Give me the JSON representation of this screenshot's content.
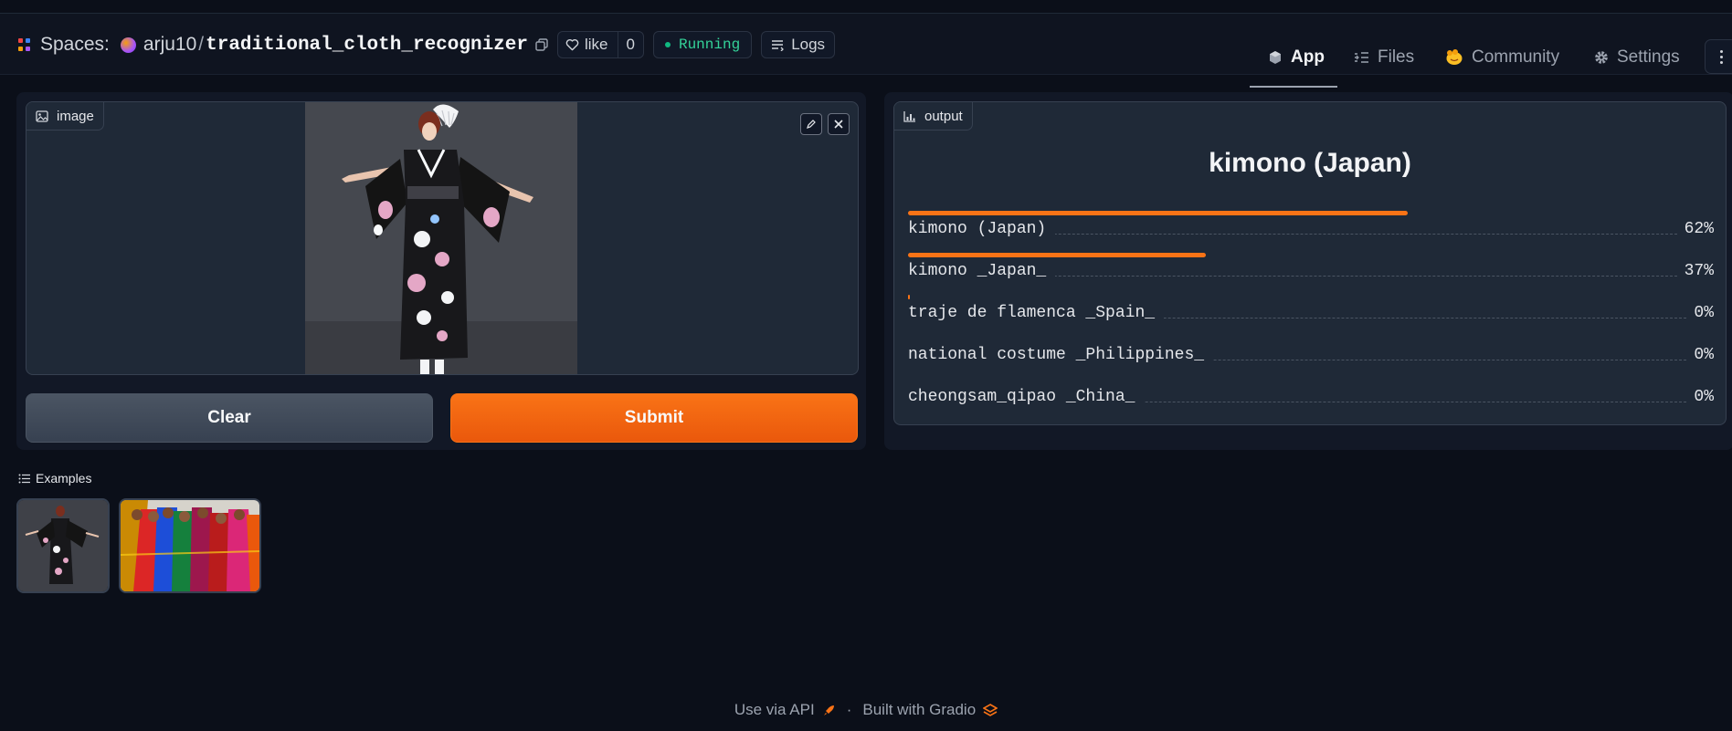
{
  "header": {
    "spaces_label": "Spaces:",
    "owner": "arju10",
    "separator": "/",
    "repo": "traditional_cloth_recognizer",
    "like_label": "like",
    "like_count": "0",
    "status": "Running",
    "logs_label": "Logs",
    "nav": [
      {
        "label": "App",
        "icon": "cube-icon",
        "active": true
      },
      {
        "label": "Files",
        "icon": "files-icon",
        "active": false
      },
      {
        "label": "Community",
        "icon": "community-icon",
        "active": false
      },
      {
        "label": "Settings",
        "icon": "gear-icon",
        "active": false
      }
    ]
  },
  "input": {
    "label": "image",
    "clear_label": "Clear",
    "submit_label": "Submit"
  },
  "output": {
    "label": "output",
    "top_label": "kimono (Japan)",
    "confidences": [
      {
        "label": "kimono (Japan)",
        "value": 0.62,
        "display": "62%"
      },
      {
        "label": "kimono _Japan_",
        "value": 0.37,
        "display": "37%"
      },
      {
        "label": "traje de flamenca _Spain_",
        "value": 0.0,
        "display": "0%"
      },
      {
        "label": "national costume _Philippines_",
        "value": 0.0,
        "display": "0%"
      },
      {
        "label": "cheongsam_qipao _China_",
        "value": 0.0,
        "display": "0%"
      }
    ]
  },
  "examples": {
    "label": "Examples"
  },
  "footer": {
    "api_label": "Use via API",
    "separator": "·",
    "built_label": "Built with Gradio"
  },
  "colors": {
    "accent": "#f97316",
    "background": "#0b0f19",
    "panel": "#1f2937",
    "running": "#10b981"
  }
}
